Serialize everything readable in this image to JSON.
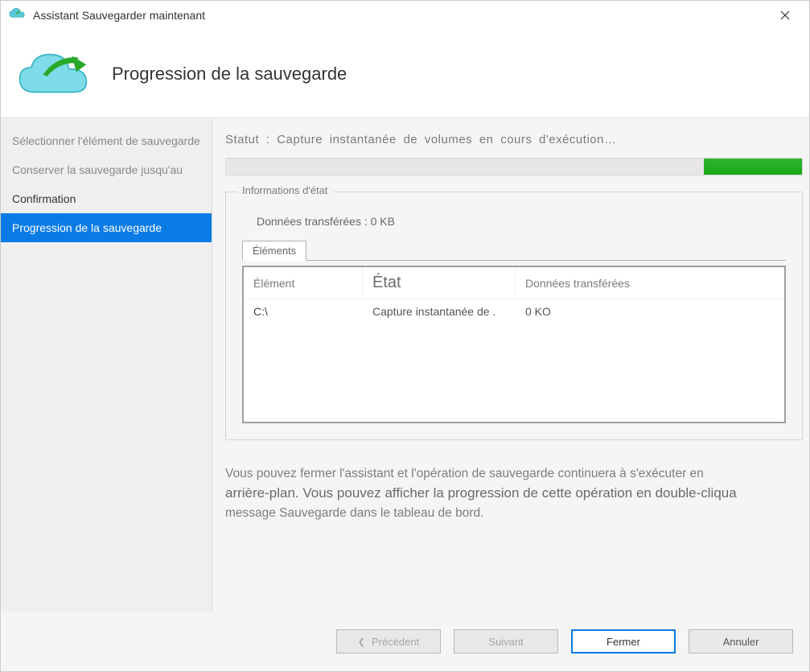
{
  "titlebar": {
    "title": "Assistant Sauvegarder maintenant"
  },
  "header": {
    "title": "Progression de la sauvegarde"
  },
  "sidebar": {
    "items": [
      {
        "label": "Sélectionner l'élément de sauvegarde"
      },
      {
        "label": "Conserver la sauvegarde jusqu'au"
      },
      {
        "label": "Confirmation"
      },
      {
        "label": "Progression de la sauvegarde"
      }
    ]
  },
  "content": {
    "status_prefix": "Statut :",
    "status_text": "Capture instantanée de volumes en cours d'exécution…",
    "fieldset_legend": "Informations d'état",
    "transfer_label": "Données transférées : 0 KB",
    "tab_label": "Éléments",
    "table": {
      "headers": {
        "c1": "Élément",
        "c2": "État",
        "c3": "Données transférées"
      },
      "row": {
        "c1": "C:\\",
        "c2": "Capture instantanée de .",
        "c3": "0 KO"
      }
    },
    "note_line1": "Vous pouvez fermer l'assistant et l'opération de sauvegarde continuera à s'exécuter en",
    "note_line2": "arrière-plan. Vous pouvez afficher la progression de cette opération en double-cliqua",
    "note_line3": "message Sauvegarde dans le tableau de bord."
  },
  "footer": {
    "prev": "Précédent",
    "next": "Suivant",
    "close": "Fermer",
    "cancel": "Annuler"
  },
  "colors": {
    "accent": "#0a7be5",
    "progress": "#1fa71f"
  }
}
